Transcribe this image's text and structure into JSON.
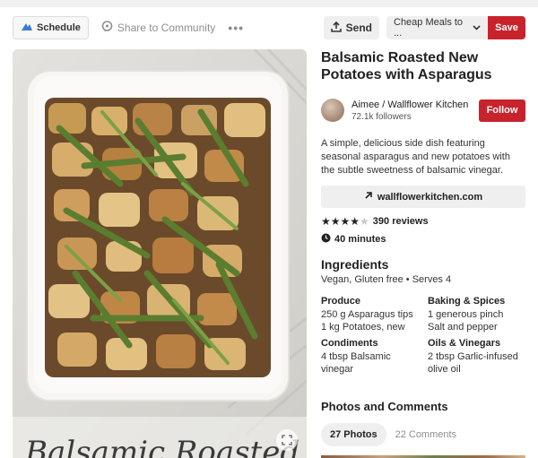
{
  "toolbar": {
    "schedule_label": "Schedule",
    "share_label": "Share to Community",
    "more_label": "•••",
    "send_label": "Send",
    "board_select_value": "Cheap Meals to ...",
    "save_label": "Save"
  },
  "pin": {
    "title": "Balsamic Roasted New Potatoes with Asparagus",
    "image_overlay_text": "Balsamic Roasted",
    "author": {
      "name": "Aimee / Wallflower Kitchen",
      "followers": "72.1k followers",
      "follow_label": "Follow"
    },
    "description": "A simple, delicious side dish featuring seasonal asparagus and new potatoes with the subtle sweetness of balsamic vinegar.",
    "link_label": "wallflowerkitchen.com",
    "rating": {
      "stars": 4,
      "max": 5,
      "reviews": "390 reviews"
    },
    "time": "40 minutes"
  },
  "ingredients": {
    "heading": "Ingredients",
    "tags": "Vegan, Gluten free • Serves 4",
    "left": [
      {
        "heading": "Produce",
        "lines": [
          "250 g Asparagus tips",
          "1 kg Potatoes, new"
        ]
      },
      {
        "heading": "Condiments",
        "lines": [
          "4 tbsp Balsamic",
          "vinegar"
        ]
      }
    ],
    "right": [
      {
        "heading": "Baking & Spices",
        "lines": [
          "1 generous pinch",
          "Salt and pepper"
        ]
      },
      {
        "heading": "Oils & Vinegars",
        "lines": [
          "2 tbsp Garlic-infused",
          "olive oil"
        ]
      }
    ]
  },
  "photos_section": {
    "heading": "Photos and Comments",
    "tab_photos": "27 Photos",
    "tab_comments": "22 Comments"
  },
  "colors": {
    "brand_red": "#c8232c",
    "button_gray": "#efefef"
  },
  "icons": [
    "schedule-icon",
    "share-icon",
    "send-icon",
    "chevron-down-icon",
    "arrow-icon",
    "clock-icon",
    "expand-icon"
  ]
}
